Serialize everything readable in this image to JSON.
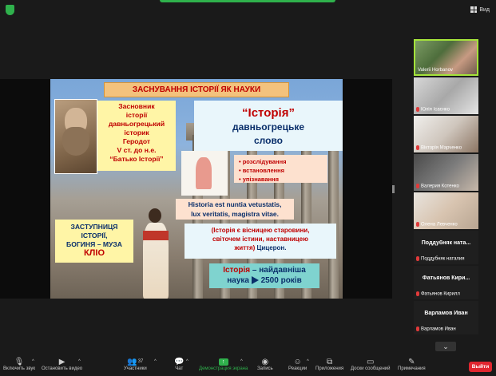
{
  "top": {
    "view_label": "Вид"
  },
  "slide": {
    "title": "ЗАСНУВАННЯ ІСТОРІЇ ЯК НАУКИ",
    "founder_lines": [
      "Засновник",
      "історії",
      "давньогрецький",
      "історик",
      "Геродот",
      "V ст. до н.е.",
      "“Батько Історії”"
    ],
    "history_word": "“Історія”",
    "history_sub_1": "давньогрецьке",
    "history_sub_2": "слово",
    "bullets": [
      "розслідування",
      "встановлення",
      "упізнавання"
    ],
    "latin_1": "Historia est nuntia vetustatis,",
    "latin_2": "lux veritatis, magistra vitae.",
    "muse_lines": [
      "ЗАСТУПНИЦЯ",
      "ІСТОРІЇ,",
      "БОГИНЯ – МУЗА"
    ],
    "muse_name": "КЛІО",
    "cicero_1": "(Історія є вісницею старовини,",
    "cicero_2": "світочем істини, наставницею",
    "cicero_3": "життя)",
    "cicero_author": "Цицерон.",
    "oldest_1_red": "Історія",
    "oldest_1_rest": " – найдавніша",
    "oldest_2a": "наука",
    "oldest_2b": "2500 років"
  },
  "participants": {
    "video": [
      {
        "name": "Valerii Horbanov",
        "muted": false
      },
      {
        "name": "Юлія Ісаєнко",
        "muted": true
      },
      {
        "name": "Вікторія Марченко",
        "muted": true
      },
      {
        "name": "Валерия Котенко",
        "muted": true
      },
      {
        "name": "Олена Левченко",
        "muted": true
      }
    ],
    "names": [
      {
        "big": "Поддубняк  натa...",
        "small": "Поддубняк наталия"
      },
      {
        "big": "Фатьянов  Кири...",
        "small": "Фатьянов Кирилл"
      },
      {
        "big": "Варламов Иван",
        "small": "Варламов Иван"
      }
    ]
  },
  "toolbar": {
    "mute": "Включить звук",
    "video": "Остановить видео",
    "participants": "Участники",
    "participants_count": "37",
    "chat": "Чат",
    "share": "Демонстрация экрана",
    "record": "Запись",
    "reactions": "Реакции",
    "apps": "Приложения",
    "whiteboard": "Доски сообщений",
    "notes": "Примечания",
    "leave": "Выйти"
  },
  "colors": {
    "accent_green": "#2fb14c",
    "leave_red": "#e0262f",
    "active_border": "#a4e33a"
  }
}
